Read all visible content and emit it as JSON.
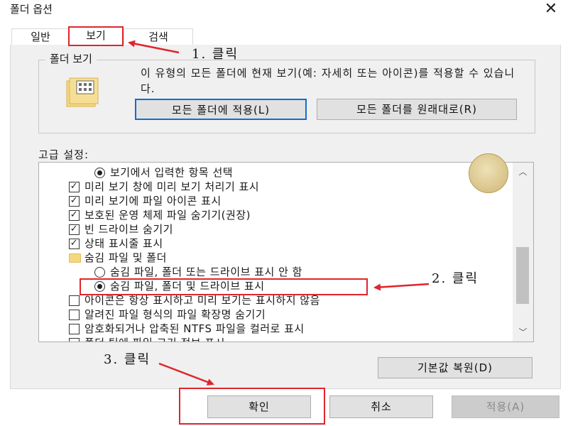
{
  "window": {
    "title": "폴더 옵션",
    "close_glyph": "✕"
  },
  "tabs": [
    {
      "label": "일반"
    },
    {
      "label": "보기"
    },
    {
      "label": "검색"
    }
  ],
  "folder_views": {
    "legend": "폴더 보기",
    "description": "이 유형의 모든 폴더에 현재 보기(예: 자세히 또는 아이콘)를 적용할 수 있습니다.",
    "apply_all_label": "모든 폴더에 적용(L)",
    "reset_label": "모든 폴더를 원래대로(R)"
  },
  "advanced": {
    "label": "고급 설정:",
    "items": [
      {
        "kind": "radio",
        "checked": true,
        "indent": 1,
        "text": "보기에서 입력한 항목 선택"
      },
      {
        "kind": "check",
        "checked": true,
        "indent": 0,
        "text": "미리 보기 창에 미리 보기 처리기 표시"
      },
      {
        "kind": "check",
        "checked": true,
        "indent": 0,
        "text": "미리 보기에 파일 아이콘 표시"
      },
      {
        "kind": "check",
        "checked": true,
        "indent": 0,
        "text": "보호된 운영 체제 파일 숨기기(권장)"
      },
      {
        "kind": "check",
        "checked": true,
        "indent": 0,
        "text": "빈 드라이브 숨기기"
      },
      {
        "kind": "check",
        "checked": true,
        "indent": 0,
        "text": "상태 표시줄 표시"
      },
      {
        "kind": "folder",
        "checked": false,
        "indent": 0,
        "text": "숨김 파일 및 폴더"
      },
      {
        "kind": "radio",
        "checked": false,
        "indent": 1,
        "text": "숨김 파일, 폴더 또는 드라이브 표시 안 함"
      },
      {
        "kind": "radio",
        "checked": true,
        "indent": 1,
        "text": "숨김 파일, 폴더 및 드라이브 표시"
      },
      {
        "kind": "check",
        "checked": false,
        "indent": 0,
        "text": "아이콘은 항상 표시하고 미리 보기는 표시하지 않음"
      },
      {
        "kind": "check",
        "checked": false,
        "indent": 0,
        "text": "알려진 파일 형식의 파일 확장명 숨기기"
      },
      {
        "kind": "check",
        "checked": false,
        "indent": 0,
        "text": "암호화되거나 압축된 NTFS 파일을 컬러로 표시"
      },
      {
        "kind": "check",
        "checked": false,
        "indent": 0,
        "text": "폴더 팁에 파일 크기 정보 표시"
      }
    ],
    "restore_label": "기본값 복원(D)"
  },
  "footer": {
    "ok_label": "확인",
    "cancel_label": "취소",
    "apply_label": "적용(A)"
  },
  "annotations": {
    "step1": "1. 클릭",
    "step2": "2. 클릭",
    "step3": "3. 클릭"
  },
  "colors": {
    "highlight_red": "#e0252b",
    "focus_blue": "#0f6ecf",
    "dialog_bg": "#f0f0f0"
  }
}
